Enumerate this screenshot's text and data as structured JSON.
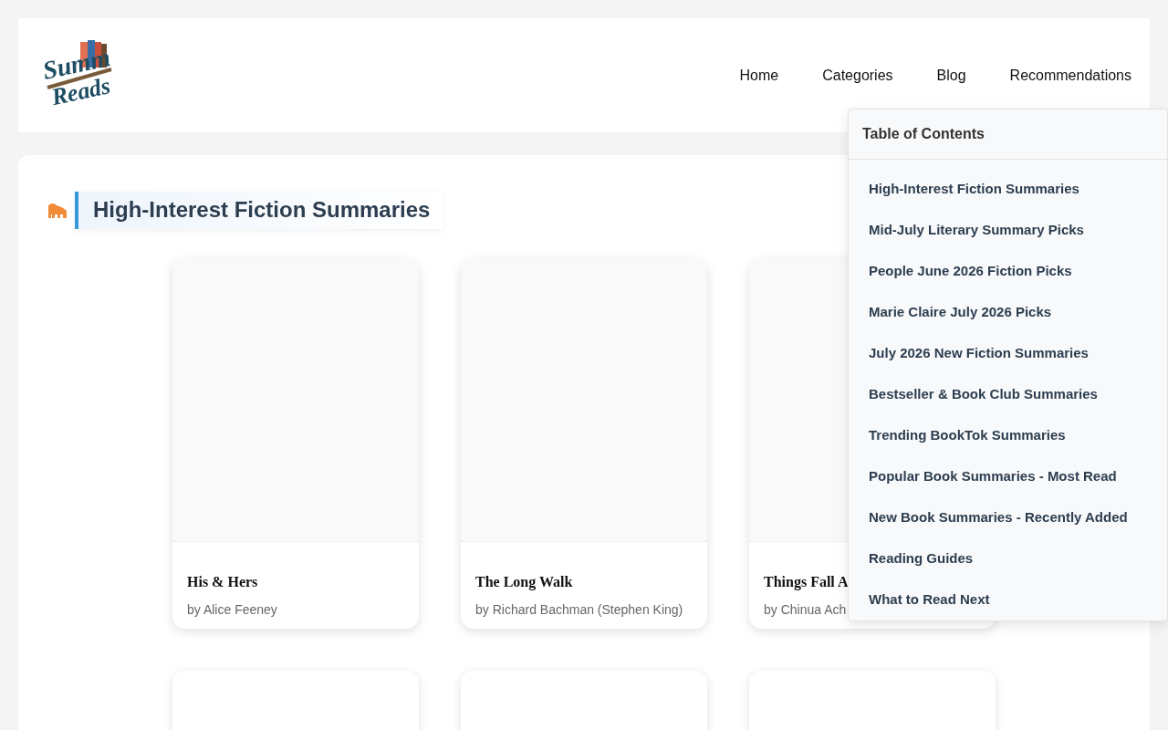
{
  "logo": {
    "line_1": "Summ",
    "line_2": "Reads"
  },
  "nav": [
    {
      "label": "Home"
    },
    {
      "label": "Categories"
    },
    {
      "label": "Blog"
    },
    {
      "label": "Recommendations"
    }
  ],
  "section": {
    "title": "High-Interest Fiction Summaries"
  },
  "books": [
    {
      "kind": "book",
      "title": "His & Hers",
      "author": "by Alice Feeney"
    },
    {
      "kind": "book",
      "title": "The Long Walk",
      "author": "by Richard Bachman (Stephen King)"
    },
    {
      "kind": "book",
      "title": "Things Fall A",
      "author": "by Chinua Ach"
    },
    {
      "kind": "placeholder"
    },
    {
      "kind": "placeholder"
    },
    {
      "kind": "placeholder"
    }
  ],
  "toc": {
    "title": "Table of Contents",
    "items": [
      {
        "label": "High-Interest Fiction Summaries"
      },
      {
        "label": "Mid-July Literary Summary Picks"
      },
      {
        "label": "People June 2026 Fiction Picks"
      },
      {
        "label": "Marie Claire July 2026 Picks"
      },
      {
        "label": "July 2026 New Fiction Summaries"
      },
      {
        "label": "Bestseller & Book Club Summaries"
      },
      {
        "label": "Trending BookTok Summaries"
      },
      {
        "label": "Popular Book Summaries - Most Read"
      },
      {
        "label": "New Book Summaries - Recently Added"
      },
      {
        "label": "Reading Guides"
      },
      {
        "label": "What to Read Next"
      }
    ]
  }
}
